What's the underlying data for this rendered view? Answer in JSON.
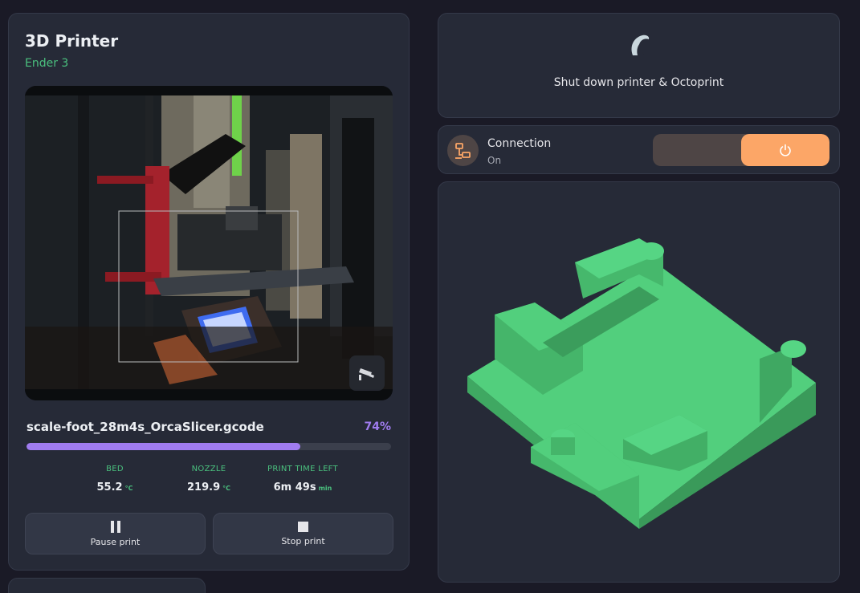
{
  "printer": {
    "title": "3D Printer",
    "subtitle": "Ender 3"
  },
  "job": {
    "filename": "scale-foot_28m4s_OrcaSlicer.gcode",
    "progress_text": "74%",
    "progress": 0.75
  },
  "stats": {
    "bed": {
      "label": "BED",
      "value": "55.2",
      "unit": "°C"
    },
    "nozzle": {
      "label": "NOZZLE",
      "value": "219.9",
      "unit": "°C"
    },
    "time_left": {
      "label": "PRINT TIME LEFT",
      "value": "6m 49s",
      "unit": "min"
    }
  },
  "actions": {
    "pause_label": "Pause print",
    "stop_label": "Stop print"
  },
  "shutdown": {
    "label": "Shut down printer & Octoprint",
    "icon": "octoprint-icon"
  },
  "connection": {
    "title": "Connection",
    "status": "On",
    "icon": "network-icon",
    "toggle_icon": "power-icon"
  },
  "colors": {
    "accent_purple": "#a07cf0",
    "accent_green": "#4ac07e",
    "accent_orange": "#fca667",
    "model_green": "#4fcb7a",
    "background": "#1a1a26",
    "card": "#262a37"
  }
}
